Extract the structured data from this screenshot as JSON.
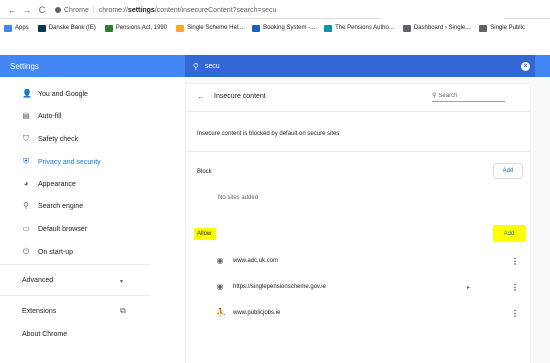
{
  "browser": {
    "back": "←",
    "forward": "→",
    "reload": "C",
    "site_name": "Chrome",
    "separator": "|",
    "url_prefix": "chrome://",
    "url_bold": "settings",
    "url_rest": "/content/insecureContent?search=secu"
  },
  "bookmarks": [
    {
      "label": "Apps",
      "color": "#4285f4"
    },
    {
      "label": "Danske Bank (IE)",
      "color": "#003755"
    },
    {
      "label": "Pensions Act, 1990",
      "color": "#2e7d32"
    },
    {
      "label": "Single Scheme Hel...",
      "color": "#f9a825"
    },
    {
      "label": "Booking System -...",
      "color": "#1565c0"
    },
    {
      "label": "The Pensions Autho...",
      "color": "#0097a7"
    },
    {
      "label": "Dashboard › Single...",
      "color": "#5f6368"
    },
    {
      "label": "Single Public",
      "color": "#5f6368"
    }
  ],
  "header": {
    "title": "Settings",
    "search_value": "secu",
    "clear": "×"
  },
  "sidebar": {
    "items": [
      {
        "label": "You and Google",
        "icon": "person-icon",
        "glyph": "👤"
      },
      {
        "label": "Auto-fill",
        "icon": "clipboard-icon",
        "glyph": "▤"
      },
      {
        "label": "Safety check",
        "icon": "shield-icon",
        "glyph": "⛉"
      },
      {
        "label": "Privacy and security",
        "icon": "shield-lock-icon",
        "glyph": "⛨"
      },
      {
        "label": "Appearance",
        "icon": "palette-icon",
        "glyph": "◕"
      },
      {
        "label": "Search engine",
        "icon": "search-icon",
        "glyph": "⚲"
      },
      {
        "label": "Default browser",
        "icon": "browser-icon",
        "glyph": "▭"
      },
      {
        "label": "On start-up",
        "icon": "power-icon",
        "glyph": "⏻"
      }
    ],
    "advanced": "Advanced",
    "advanced_chevron": "▾",
    "extensions": "Extensions",
    "extensions_open": "⧉",
    "about": "About Chrome"
  },
  "main": {
    "back": "←",
    "title": "Insecure content",
    "search_glyph": "⚲",
    "search_placeholder": "Search",
    "description": "Insecure content is blocked by default on secure sites",
    "block": {
      "label": "Block",
      "add": "Add",
      "empty": "No sites added"
    },
    "allow": {
      "label": "Allow",
      "add": "Add",
      "sites": [
        {
          "url": "www.adc.uk.com",
          "icon": "globe-icon",
          "glyph": "◉",
          "arrow": ""
        },
        {
          "url": "https://singlepensionscheme.gov.ie",
          "icon": "globe-icon",
          "glyph": "◉",
          "arrow": "▸"
        },
        {
          "url": "www.publicjobs.ie",
          "icon": "publicjobs-icon",
          "glyph": "⛹",
          "arrow": ""
        }
      ],
      "more": "⋮"
    },
    "highlight_color": "#ffff00"
  }
}
